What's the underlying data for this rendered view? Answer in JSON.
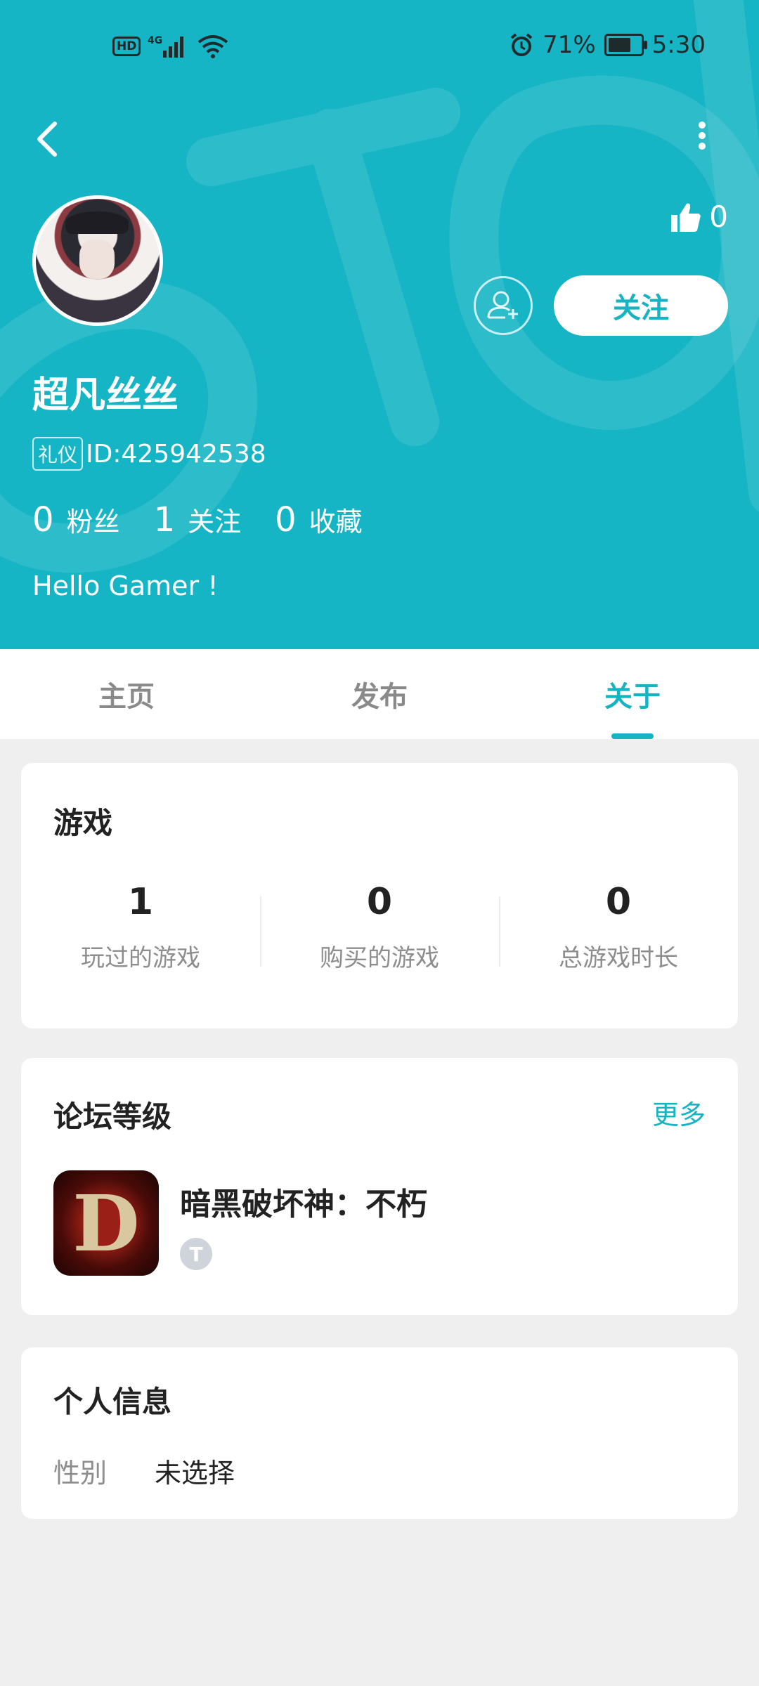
{
  "status_bar": {
    "network_badge": "HD",
    "signal_type": "4G",
    "alarm_icon": "alarm-icon",
    "battery_pct": "71%",
    "battery_level": 0.71,
    "time": "5:30"
  },
  "header": {
    "background_color": "#16b5c5",
    "likes_count": "0",
    "follow_label": "关注",
    "username": "超凡丝丝",
    "badge": "礼仪",
    "user_id": "ID:425942538",
    "stats": [
      {
        "num": "0",
        "label": "粉丝"
      },
      {
        "num": "1",
        "label": "关注"
      },
      {
        "num": "0",
        "label": "收藏"
      }
    ],
    "bio": "Hello Gamer !"
  },
  "tabs": [
    {
      "label": "主页",
      "active": false
    },
    {
      "label": "发布",
      "active": false
    },
    {
      "label": "关于",
      "active": true
    }
  ],
  "games_card": {
    "title": "游戏",
    "stats": [
      {
        "value": "1",
        "label": "玩过的游戏"
      },
      {
        "value": "0",
        "label": "购买的游戏"
      },
      {
        "value": "0",
        "label": "总游戏时长"
      }
    ]
  },
  "forum_card": {
    "title": "论坛等级",
    "more_label": "更多",
    "game_name": "暗黑破坏神：不朽",
    "icon_letter": "D",
    "rank_badge": "T"
  },
  "personal_card": {
    "title": "个人信息",
    "gender_label": "性别",
    "gender_value": "未选择"
  },
  "accent_color": "#16b3c3"
}
